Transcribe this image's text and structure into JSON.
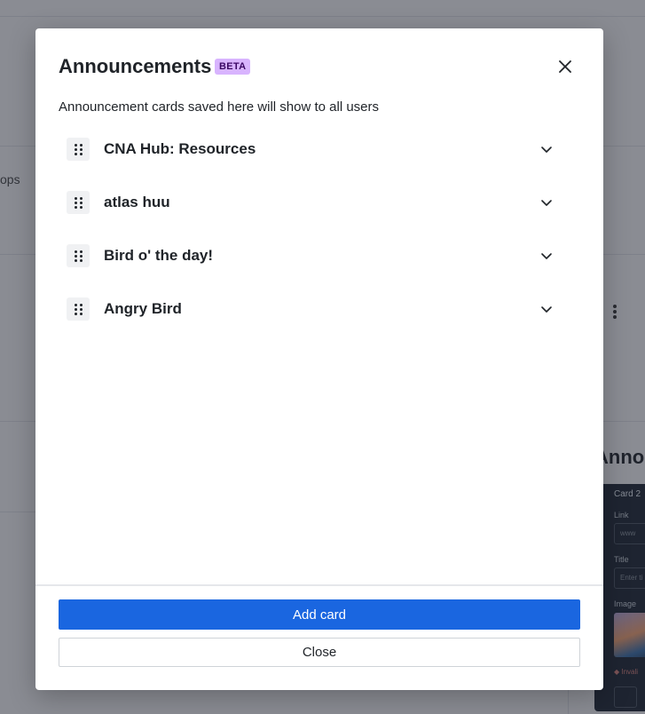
{
  "background": {
    "fragment_text": "ops",
    "panel_title_fragment": "Annou",
    "panel": {
      "card_label": "Card 2",
      "link_label": "Link",
      "link_value": "www",
      "title_label": "Title",
      "title_placeholder": "Enter ti",
      "image_label": "Image",
      "warning_fragment": "Invali"
    }
  },
  "modal": {
    "title": "Announcements",
    "badge": "BETA",
    "subtitle": "Announcement cards saved here will show to all users",
    "cards": [
      {
        "title": "CNA Hub: Resources"
      },
      {
        "title": "atlas huu"
      },
      {
        "title": "Bird o' the day!"
      },
      {
        "title": "Angry Bird"
      }
    ],
    "add_button": "Add card",
    "close_button": "Close"
  },
  "colors": {
    "primary": "#1a66e0",
    "badge_bg": "#d8b4fe",
    "badge_text": "#3b0764"
  },
  "icons": {
    "close": "close-icon",
    "drag": "drag-handle-icon",
    "chevron": "chevron-down-icon"
  }
}
